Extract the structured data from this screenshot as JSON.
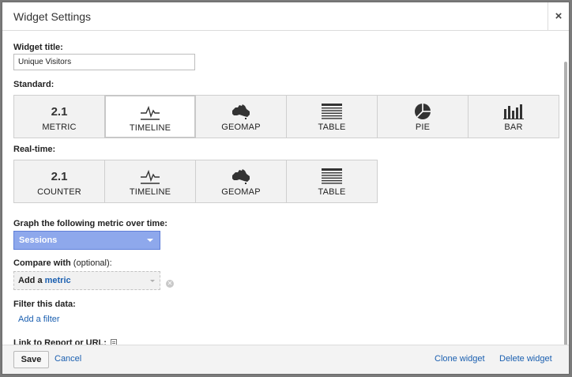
{
  "dialog": {
    "title": "Widget Settings",
    "close_glyph": "×"
  },
  "form": {
    "widget_title_label": "Widget title:",
    "widget_title_value": "Unique Visitors",
    "standard_label": "Standard:",
    "realtime_label": "Real-time:",
    "graph_metric_label": "Graph the following metric over time:",
    "graph_metric_value": "Sessions",
    "compare_label": "Compare with",
    "compare_optional": "(optional):",
    "compare_prefix": "Add a",
    "compare_metric": "metric",
    "filter_label": "Filter this data:",
    "add_filter": "Add a filter",
    "link_label": "Link to Report or URL:"
  },
  "standard_tiles": [
    {
      "label": "METRIC",
      "icon": "number-icon",
      "icon_text": "2.1",
      "selected": false
    },
    {
      "label": "TIMELINE",
      "icon": "timeline-icon",
      "selected": true
    },
    {
      "label": "GEOMAP",
      "icon": "australia-map-icon",
      "selected": false
    },
    {
      "label": "TABLE",
      "icon": "table-icon",
      "selected": false
    },
    {
      "label": "PIE",
      "icon": "pie-icon",
      "selected": false
    },
    {
      "label": "BAR",
      "icon": "bar-icon",
      "selected": false
    }
  ],
  "realtime_tiles": [
    {
      "label": "COUNTER",
      "icon": "number-icon",
      "icon_text": "2.1",
      "selected": false
    },
    {
      "label": "TIMELINE",
      "icon": "timeline-icon",
      "selected": false
    },
    {
      "label": "GEOMAP",
      "icon": "australia-map-icon",
      "selected": false
    },
    {
      "label": "TABLE",
      "icon": "table-icon",
      "selected": false
    }
  ],
  "footer": {
    "save": "Save",
    "cancel": "Cancel",
    "clone": "Clone widget",
    "delete": "Delete widget"
  },
  "colors": {
    "metric_select_bg": "#8ea8ec",
    "link": "#1a5fb0"
  }
}
